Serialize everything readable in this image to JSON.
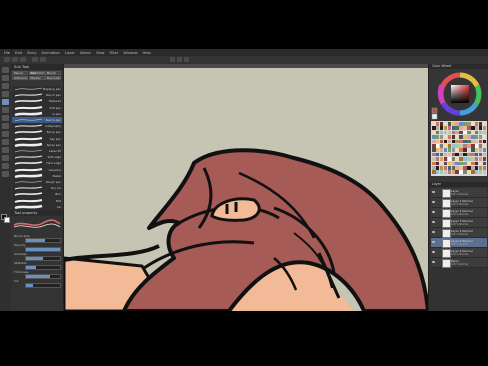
{
  "menu": [
    "File",
    "Edit",
    "Story",
    "Animation",
    "Layer",
    "Select",
    "View",
    "Filter",
    "Window",
    "Help"
  ],
  "panels": {
    "subtool_title": "Sub Tool",
    "tool_property_title": "Tool property",
    "color_title": "Color Wheel",
    "layer_title": "Layer"
  },
  "subtool_tabs": [
    "Pencil",
    "Pen",
    "Brush",
    "Airbrush",
    "Marker",
    "Decoration"
  ],
  "brushes": [
    "Mapping pen",
    "Round pen",
    "Textured",
    "Soft pen",
    "G-pen",
    "Real G-pen",
    "Calligraphy",
    "Turnip pen",
    "Saji pen",
    "Spray pen",
    "Lasso fill",
    "Soft edge",
    "Hard edge",
    "Gouache",
    "Pastel",
    "Rough pen",
    "Dry ink",
    "Blur",
    "Felt",
    "Ink"
  ],
  "selected_brush_index": 5,
  "tool_props": [
    {
      "label": "Brush Size",
      "value": 0.55
    },
    {
      "label": "Opacity",
      "value": 1.0
    },
    {
      "label": "Antialias",
      "value": 0.5
    },
    {
      "label": "Stabilize",
      "value": 0.3
    },
    {
      "label": "Thickness",
      "value": 0.7
    },
    {
      "label": "Ink",
      "value": 0.2
    }
  ],
  "layers": [
    {
      "name": "Layer",
      "pct": "100 % Normal"
    },
    {
      "name": "Layer 1 Normal",
      "pct": "100 % Normal"
    },
    {
      "name": "Layer 2 Normal",
      "pct": "100 % Normal"
    },
    {
      "name": "Layer 3 Normal",
      "pct": "100 % Normal"
    },
    {
      "name": "Layer 4 Normal",
      "pct": "100 % Normal"
    },
    {
      "name": "Layer 5 Normal",
      "pct": "100 % Normal"
    },
    {
      "name": "Layer 6 Normal",
      "pct": "100 % Normal"
    },
    {
      "name": "Paper",
      "pct": "100 % Normal"
    }
  ],
  "selected_layer_index": 5,
  "colors": {
    "canvas_bg": "#c6c4b2",
    "hair": "#a65b57",
    "skin": "#f2ba96",
    "line": "#111111",
    "selection": "#3a5a8a"
  },
  "icons": [
    "pen-icon",
    "eraser-icon",
    "fill-icon",
    "move-icon",
    "eye-icon"
  ]
}
